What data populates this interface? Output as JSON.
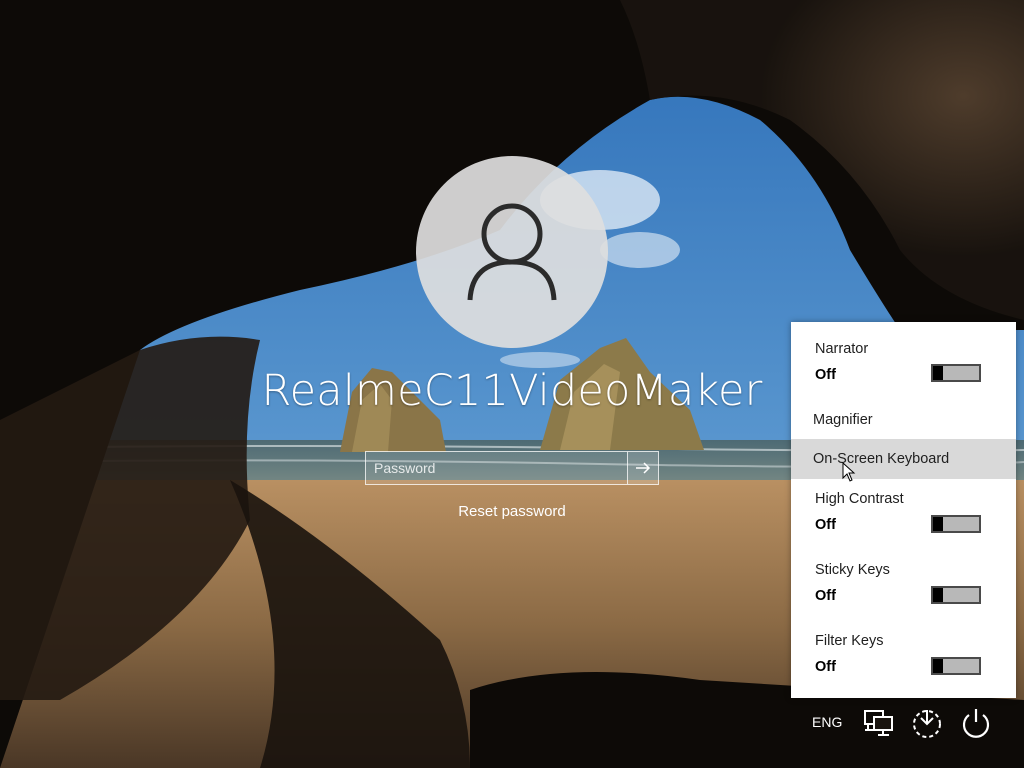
{
  "login": {
    "username": "RealmeC11VideoMaker",
    "password_placeholder": "Password",
    "reset_link": "Reset password"
  },
  "ease_of_access": {
    "items": [
      {
        "label": "Narrator",
        "state": "Off",
        "has_toggle": true
      },
      {
        "label": "Magnifier",
        "state": null,
        "has_toggle": false
      },
      {
        "label": "On-Screen Keyboard",
        "state": null,
        "has_toggle": false,
        "highlighted": true
      },
      {
        "label": "High Contrast",
        "state": "Off",
        "has_toggle": true
      },
      {
        "label": "Sticky Keys",
        "state": "Off",
        "has_toggle": true
      },
      {
        "label": "Filter Keys",
        "state": "Off",
        "has_toggle": true
      }
    ]
  },
  "taskbar": {
    "language": "ENG",
    "icons": [
      "network-icon",
      "ease-of-access-icon",
      "power-icon"
    ]
  },
  "colors": {
    "flyout_bg": "#ffffff",
    "highlight": "#d9d9d9",
    "toggle_track": "#b8b8b8",
    "avatar_bg": "#dedede"
  }
}
